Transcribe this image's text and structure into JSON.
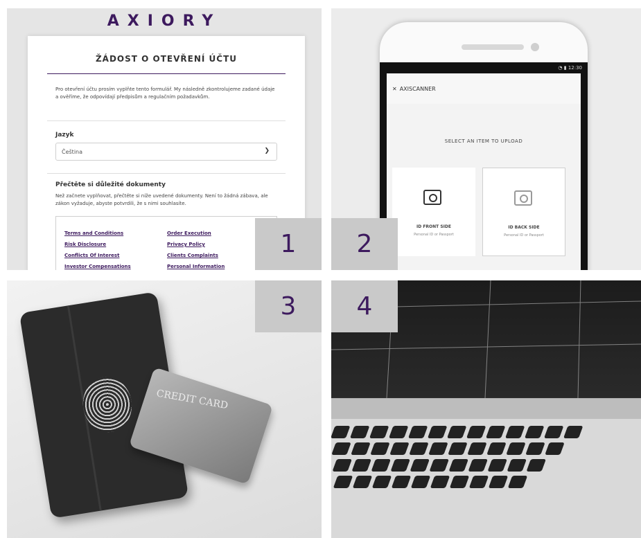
{
  "tiles": {
    "t1": {
      "badge": "1",
      "logo": "AXIORY",
      "form_title": "ŽÁDOST O OTEVŘENÍ ÚČTU",
      "intro": "Pro otevření účtu prosím vyplňte tento formulář. My následně zkontrolujeme zadané údaje a ověříme, že odpovídají předpisům a regulačním požadavkům.",
      "language_label": "Jazyk",
      "language_value": "Čeština",
      "docs_heading": "Přečtěte si důležité dokumenty",
      "docs_text": "Než začnete vyplňovat, přečtěte si níže uvedené dokumenty. Není to žádná zábava, ale zákon vyžaduje, abyste potvrdili, že s nimi souhlasíte.",
      "doc_links": [
        "Terms and Conditions",
        "Order Execution",
        "Risk Disclosure",
        "Privacy Policy",
        "Conflicts Of Interest",
        "Clients Complaints",
        "Investor Compensations",
        "Personal Information"
      ]
    },
    "t2": {
      "badge": "2",
      "status_time": "12:30",
      "app_name": "AXISCANNER",
      "instruction": "SELECT AN ITEM TO UPLOAD",
      "front_title": "ID FRONT SIDE",
      "front_sub": "Personal ID or Passport",
      "back_title": "ID BACK SIDE",
      "back_sub": "Personal ID or Passport"
    },
    "t3": {
      "badge": "3",
      "card_text": "CREDIT CARD"
    },
    "t4": {
      "badge": "4"
    }
  },
  "colors": {
    "brand": "#3d1a5e",
    "badge_bg": "#c9c9c9"
  }
}
